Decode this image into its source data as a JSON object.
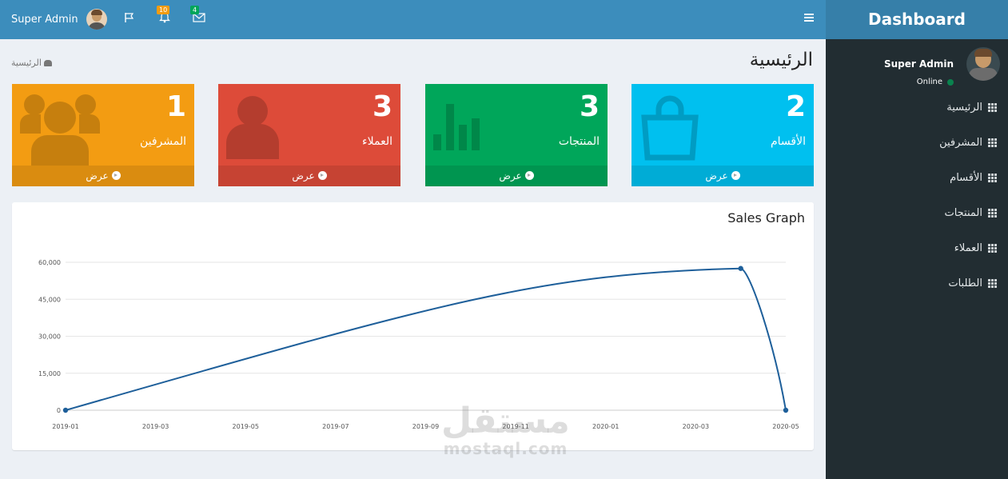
{
  "header": {
    "user_name": "Super Admin",
    "notifications_count": "10",
    "messages_count": "4",
    "icons": [
      "flag-icon",
      "bell-icon",
      "envelope-icon",
      "hamburger-icon"
    ]
  },
  "brand": {
    "title": "Dashboard"
  },
  "sidebar": {
    "user_name": "Super Admin",
    "status": "Online",
    "items": [
      {
        "label": "الرئيسية"
      },
      {
        "label": "المشرفين"
      },
      {
        "label": "الأقسام"
      },
      {
        "label": "المنتجات"
      },
      {
        "label": "العملاء"
      },
      {
        "label": "الطلبات"
      }
    ]
  },
  "page": {
    "title": "الرئيسية",
    "breadcrumb": "الرئيسية"
  },
  "stats": [
    {
      "value": "2",
      "label": "الأقسام",
      "link": "عرض",
      "color": "#00c0ef",
      "icon": "shopping-bag-icon"
    },
    {
      "value": "3",
      "label": "المنتجات",
      "link": "عرض",
      "color": "#00a65a",
      "icon": "bar-chart-icon"
    },
    {
      "value": "3",
      "label": "العملاء",
      "link": "عرض",
      "color": "#dd4b39",
      "icon": "user-icon"
    },
    {
      "value": "1",
      "label": "المشرفين",
      "link": "عرض",
      "color": "#f39c12",
      "icon": "users-icon"
    }
  ],
  "sales": {
    "title": "Sales Graph"
  },
  "chart_data": {
    "type": "line",
    "title": "Sales Graph",
    "xlabel": "",
    "ylabel": "",
    "x": [
      "2019-01",
      "2020-04",
      "2020-05"
    ],
    "series": [
      {
        "values": [
          0,
          57500,
          0
        ],
        "color": "#3c8dbc"
      }
    ],
    "xticks": [
      "2019-01",
      "2019-03",
      "2019-05",
      "2019-07",
      "2019-09",
      "2019-11",
      "2020-01",
      "2020-03",
      "2020-05"
    ],
    "yticks": [
      "0",
      "15,000",
      "30,000",
      "45,000",
      "60,000"
    ],
    "ylim": [
      0,
      60000
    ],
    "grid": true
  },
  "watermark": {
    "arabic": "مستقل",
    "latin": "mostaql.com"
  }
}
